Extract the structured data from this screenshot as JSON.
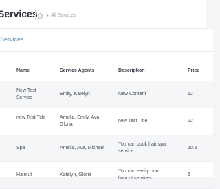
{
  "header": {
    "title": "Services",
    "breadcrumb": {
      "home_icon": "home-icon",
      "separator_icon": "chevron-right-icon",
      "current": "All Services"
    }
  },
  "card": {
    "title": "Services"
  },
  "table": {
    "columns": [
      "",
      "Name",
      "Service Agents",
      "Description",
      "Price"
    ],
    "rows": [
      {
        "id": "3",
        "name": "New Test Service",
        "agents": "Emily, Katelyn",
        "description": "New Content",
        "price": "12"
      },
      {
        "id": "5",
        "name": "new Test Title",
        "agents": "Amelia, Emily, Ava, Gloria",
        "description": "new Test Title",
        "price": "22"
      },
      {
        "id": "1",
        "name": "Spa",
        "agents": "Amelia, Ava, Michael",
        "description": "You can book hair spa service.",
        "price": "10.5"
      },
      {
        "id": "",
        "name": "Haircut",
        "agents": "Katelyn, Gloria",
        "description": "You can easily boot haircut services",
        "price": "6"
      }
    ]
  },
  "colors": {
    "title": "#2b2f36",
    "card_title": "#5e8fb6",
    "shaded_row": "#f5f6f8"
  }
}
